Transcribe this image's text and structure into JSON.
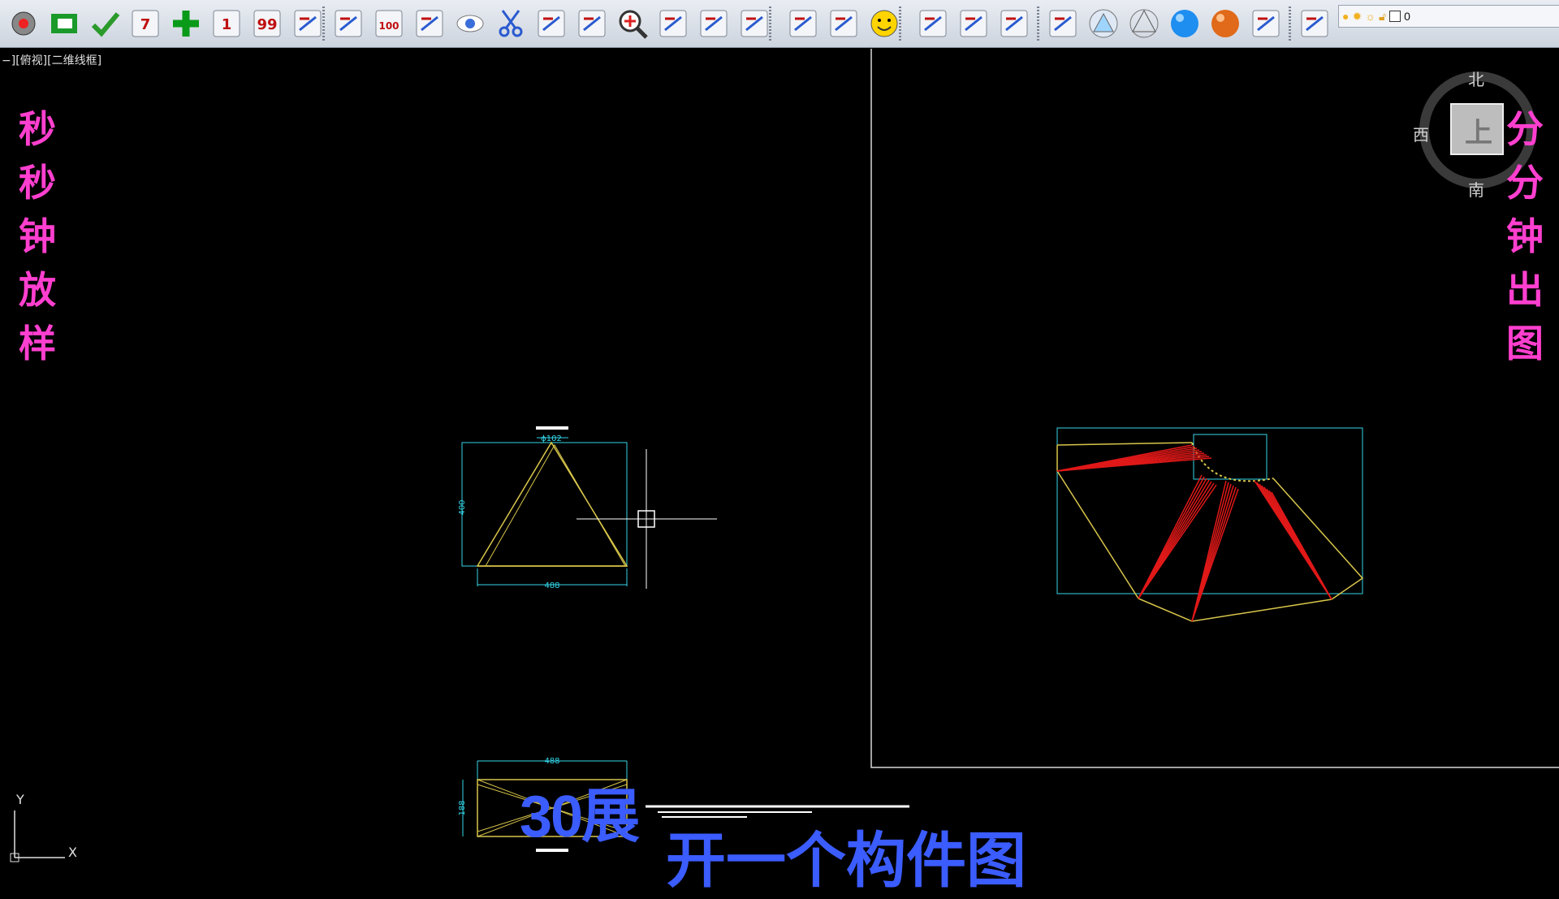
{
  "toolbar": {
    "buttons": [
      {
        "name": "settings-icon"
      },
      {
        "name": "component-icon"
      },
      {
        "name": "check-icon"
      },
      {
        "name": "calendar-7-icon",
        "text": "7"
      },
      {
        "name": "add-icon"
      },
      {
        "name": "number-1-icon",
        "text": "1"
      },
      {
        "name": "number-99-icon",
        "text": "99"
      },
      {
        "name": "arc-tool-icon"
      },
      {
        "name": "point-pick-icon"
      },
      {
        "name": "elevation-100-icon",
        "text": "100"
      },
      {
        "name": "list-icon"
      },
      {
        "name": "eye-icon"
      },
      {
        "name": "scissors-icon"
      },
      {
        "name": "dimension-icon"
      },
      {
        "name": "checklist-icon"
      },
      {
        "name": "zoom-icon"
      },
      {
        "name": "layer-edit-icon"
      },
      {
        "name": "pan-hand-icon"
      },
      {
        "name": "calculator-icon"
      },
      {
        "name": "refresh-icon"
      },
      {
        "name": "checklist-board-icon"
      },
      {
        "name": "smiley-icon"
      },
      {
        "name": "orbit-icon"
      },
      {
        "name": "free-orbit-icon"
      },
      {
        "name": "continuous-orbit-icon"
      },
      {
        "name": "view-cube-icon"
      },
      {
        "name": "shade-triangle-icon"
      },
      {
        "name": "wire-triangle-icon"
      },
      {
        "name": "blue-sphere-icon"
      },
      {
        "name": "orange-sphere-icon"
      },
      {
        "name": "visual-style-icon"
      },
      {
        "name": "layer-manager-icon"
      }
    ],
    "layer_combo": {
      "value": "0"
    }
  },
  "viewport": {
    "label": "−][俯视][二维线框]"
  },
  "left_title": [
    "秒",
    "秒",
    "钟",
    "放",
    "样"
  ],
  "right_title": [
    "分",
    "分",
    "钟",
    "出",
    "图"
  ],
  "viewcube": {
    "top_label": "上",
    "north": "北",
    "south": "南",
    "west": "西"
  },
  "drawing": {
    "triangle_dims": {
      "top": "ϕ102",
      "side": "400",
      "bottom": "488"
    },
    "rect_dims": {
      "top": "488",
      "side": "188"
    }
  },
  "subtitle": {
    "line1": "30展",
    "line2": "开一个构件图"
  },
  "ucs": {
    "x": "X",
    "y": "Y"
  },
  "colors": {
    "accent_pink": "#ff3fcf",
    "subtitle_blue": "#3b5cff",
    "cad_cyan": "#33d6e8",
    "cad_yellow": "#d8c64a",
    "cad_red": "#e01818"
  }
}
